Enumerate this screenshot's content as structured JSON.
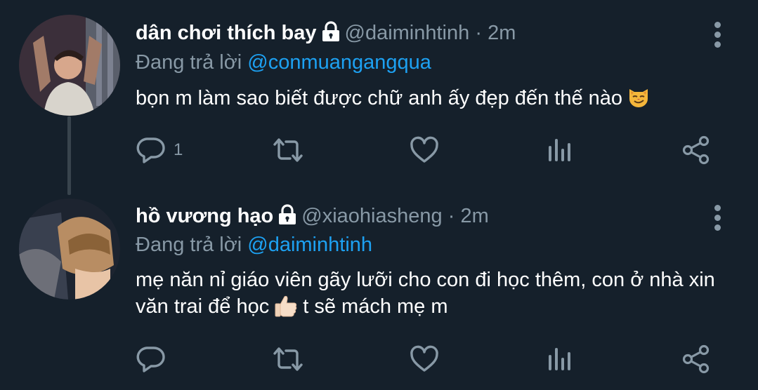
{
  "tweets": [
    {
      "name": "dân chơi thích bay",
      "handle": "@daiminhtinh",
      "dot": "·",
      "time": "2m",
      "replying_prefix": "Đang trả lời",
      "replying_to": "@conmuangangqua",
      "text_before_emoji": "bọn m làm sao biết được chữ anh ấy đẹp đến thế nào",
      "text_after_emoji": "",
      "emoji": "smirking-cat-face",
      "reply_count": "1"
    },
    {
      "name": "hồ vương hạo",
      "handle": "@xiaohiasheng",
      "dot": "·",
      "time": "2m",
      "replying_prefix": "Đang trả lời",
      "replying_to": "@daiminhtinh",
      "text_before_emoji": "mẹ năn nỉ giáo viên gãy lưỡi cho con đi học thêm, con ở nhà xin văn trai để học",
      "text_after_emoji": "t sẽ mách mẹ m",
      "emoji": "thumbs-up-light-skin",
      "reply_count": ""
    }
  ],
  "icons": {
    "reply": "reply-icon",
    "retweet": "retweet-icon",
    "like": "heart-icon",
    "analytics": "analytics-icon",
    "share": "share-icon",
    "more": "more-vertical-icon",
    "protected": "lock-icon"
  },
  "colors": {
    "background": "#15202b",
    "secondary_text": "#8899a6",
    "accent": "#1da1f2",
    "thread_line": "#38444d"
  }
}
